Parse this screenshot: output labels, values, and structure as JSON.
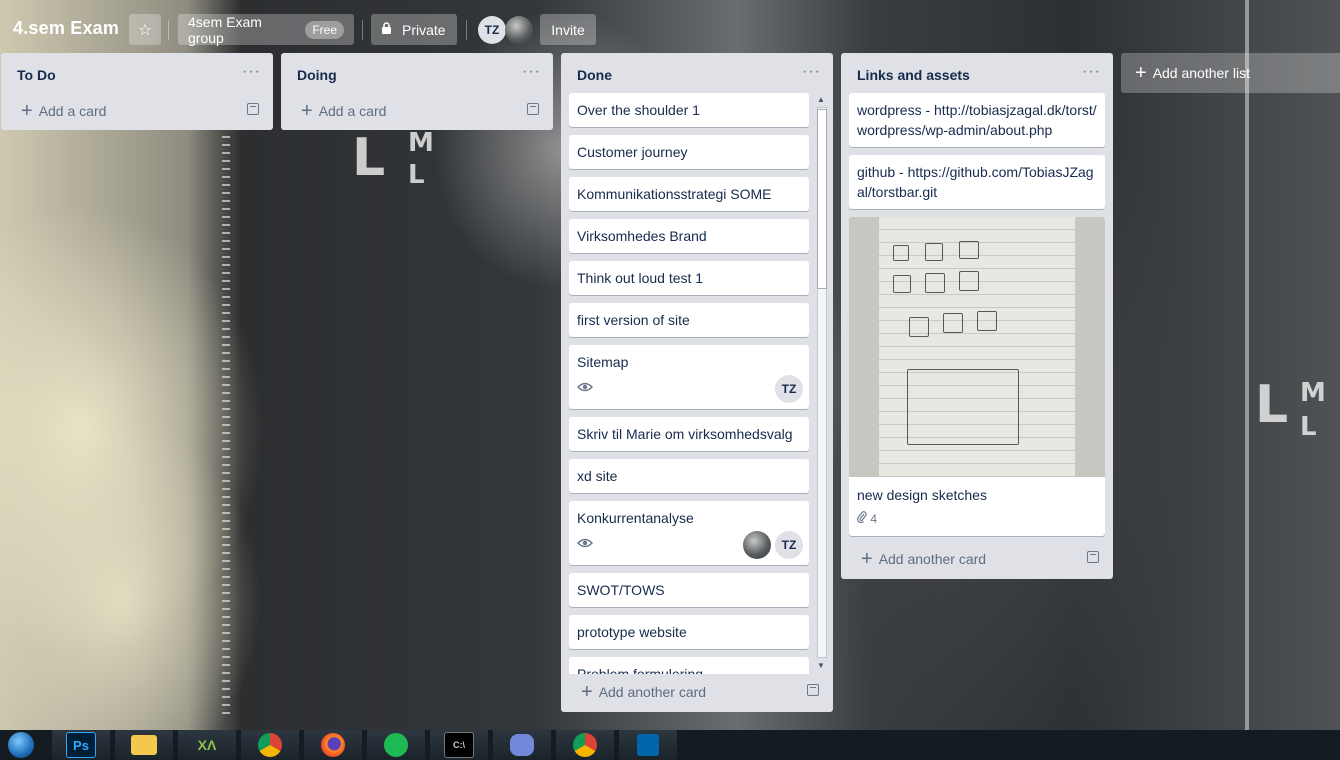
{
  "board": {
    "title": "4.sem Exam",
    "team_label": "4sem Exam group",
    "team_badge": "Free",
    "visibility_label": "Private",
    "invite_label": "Invite",
    "member_initials": "TZ"
  },
  "lists": [
    {
      "title": "To Do",
      "add_label": "Add a card"
    },
    {
      "title": "Doing",
      "add_label": "Add a card"
    },
    {
      "title": "Done",
      "add_label": "Add another card",
      "cards": [
        "Over the shoulder 1",
        "Customer journey",
        "Kommunikationsstrategi SOME",
        "Virksomhedes Brand",
        "Think out loud test 1",
        "first version of site",
        "Sitemap",
        "Skriv til Marie om virksomhedsvalg",
        "xd site",
        "Konkurrentanalyse",
        "SWOT/TOWS",
        "prototype website",
        "Problem formulering"
      ],
      "sitemap_member": "TZ",
      "konkurrent_member": "TZ"
    },
    {
      "title": "Links and assets",
      "add_label": "Add another card",
      "cards": [
        "wordpress - http://tobiasjzagal.dk/torst/wordpress/wp-admin/about.php",
        "github - https://github.com/TobiasJZagal/torstbar.git",
        "new design sketches"
      ],
      "attachment_count": "4"
    }
  ],
  "add_list_label": "Add another list",
  "taskbar": {
    "apps": [
      "photoshop-icon",
      "file-explorer-icon",
      "xampp-icon",
      "chrome-icon",
      "firefox-icon",
      "spotify-icon",
      "cmd-icon",
      "discord-icon",
      "chrome-icon",
      "vscode-icon"
    ],
    "labels": [
      "Ps",
      "",
      "ΧΛ",
      "",
      "",
      "",
      "C:\\",
      "",
      "",
      ""
    ]
  },
  "colors": {
    "list_bg": "#dfe1e6",
    "card_bg": "#ffffff",
    "label_red": "#eb5a46",
    "text": "#172b4d"
  }
}
